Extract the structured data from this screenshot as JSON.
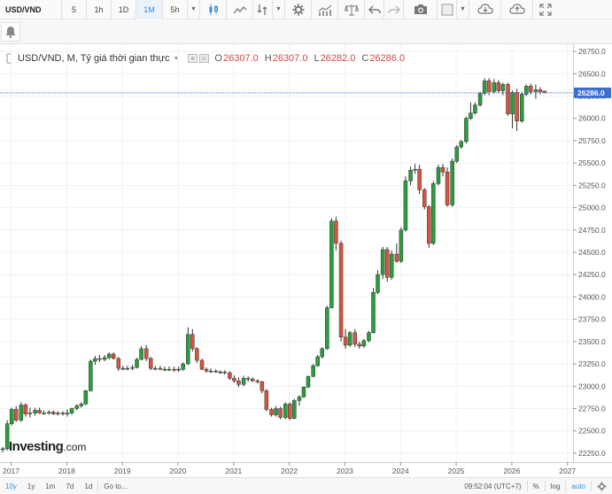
{
  "toolbar": {
    "symbol": "USD/VND",
    "intervals": [
      {
        "label": "5",
        "active": false
      },
      {
        "label": "1h",
        "active": false
      },
      {
        "label": "1D",
        "active": false
      },
      {
        "label": "1M",
        "active": true
      },
      {
        "label": "5h",
        "active": false
      }
    ],
    "icons": [
      "candlestick-icon",
      "line-chart-icon",
      "indicators-icon",
      "settings-icon",
      "bar-chart-icon",
      "scales-icon",
      "undo-icon",
      "redo-icon",
      "camera-icon",
      "square-icon",
      "cloud-down-icon",
      "cloud-up-icon",
      "fullscreen-icon"
    ]
  },
  "legend": {
    "title": "USD/VND, M, Tỷ giá thời gian thực",
    "open_label": "O",
    "open": "26307.0",
    "high_label": "H",
    "high": "26307.0",
    "low_label": "L",
    "low": "26282.0",
    "close_label": "C",
    "close": "26286.0"
  },
  "bottombar": {
    "ranges": [
      {
        "label": "10y",
        "active": true
      },
      {
        "label": "1y",
        "active": false
      },
      {
        "label": "1m",
        "active": false
      },
      {
        "label": "7d",
        "active": false
      },
      {
        "label": "1d",
        "active": false
      }
    ],
    "goto": "Go to...",
    "time": "09:52:04 (UTC+7)",
    "percent": "%",
    "log": "log",
    "auto": "auto"
  },
  "brand": {
    "name": "Investing",
    "suffix": ".com"
  },
  "colors": {
    "up": "#2a9d3f",
    "down": "#d75442",
    "price_line": "#3b6fcf",
    "price_tag": "#3b6fcf",
    "grid": "#f1f1f1"
  },
  "chart_data": {
    "type": "candlestick",
    "interval": "monthly",
    "y_ticks": [
      22250,
      22500,
      22750,
      23000,
      23250,
      23500,
      23750,
      24000,
      24250,
      24500,
      24750,
      25000,
      25250,
      25500,
      25750,
      26000,
      26250,
      26500,
      26750
    ],
    "y_range": [
      22150,
      26830
    ],
    "x_ticks": [
      "2017",
      "2018",
      "2019",
      "2020",
      "2021",
      "2022",
      "2023",
      "2024",
      "2025",
      "2026",
      "2027"
    ],
    "x_range": [
      2016.8,
      2027.1
    ],
    "last_price": 26286.0,
    "last_price_label": "26286.0",
    "candles": [
      {
        "t": 2016.85,
        "o": 22290,
        "h": 22320,
        "l": 22260,
        "c": 22300
      },
      {
        "t": 2016.93,
        "o": 22300,
        "h": 22620,
        "l": 22280,
        "c": 22580
      },
      {
        "t": 2017.01,
        "o": 22580,
        "h": 22760,
        "l": 22560,
        "c": 22740
      },
      {
        "t": 2017.09,
        "o": 22740,
        "h": 22780,
        "l": 22600,
        "c": 22620
      },
      {
        "t": 2017.18,
        "o": 22620,
        "h": 22820,
        "l": 22600,
        "c": 22790
      },
      {
        "t": 2017.26,
        "o": 22790,
        "h": 22810,
        "l": 22660,
        "c": 22690
      },
      {
        "t": 2017.34,
        "o": 22690,
        "h": 22760,
        "l": 22650,
        "c": 22700
      },
      {
        "t": 2017.43,
        "o": 22700,
        "h": 22760,
        "l": 22670,
        "c": 22730
      },
      {
        "t": 2017.51,
        "o": 22730,
        "h": 22760,
        "l": 22690,
        "c": 22700
      },
      {
        "t": 2017.59,
        "o": 22700,
        "h": 22730,
        "l": 22680,
        "c": 22700
      },
      {
        "t": 2017.68,
        "o": 22700,
        "h": 22730,
        "l": 22680,
        "c": 22710
      },
      {
        "t": 2017.76,
        "o": 22710,
        "h": 22730,
        "l": 22680,
        "c": 22690
      },
      {
        "t": 2017.84,
        "o": 22690,
        "h": 22720,
        "l": 22670,
        "c": 22700
      },
      {
        "t": 2017.93,
        "o": 22700,
        "h": 22720,
        "l": 22670,
        "c": 22690
      },
      {
        "t": 2018.01,
        "o": 22690,
        "h": 22740,
        "l": 22660,
        "c": 22700
      },
      {
        "t": 2018.09,
        "o": 22700,
        "h": 22760,
        "l": 22680,
        "c": 22750
      },
      {
        "t": 2018.18,
        "o": 22750,
        "h": 22800,
        "l": 22730,
        "c": 22780
      },
      {
        "t": 2018.26,
        "o": 22780,
        "h": 22820,
        "l": 22760,
        "c": 22800
      },
      {
        "t": 2018.34,
        "o": 22800,
        "h": 22960,
        "l": 22790,
        "c": 22950
      },
      {
        "t": 2018.43,
        "o": 22950,
        "h": 23300,
        "l": 22940,
        "c": 23280
      },
      {
        "t": 2018.51,
        "o": 23280,
        "h": 23340,
        "l": 23240,
        "c": 23310
      },
      {
        "t": 2018.59,
        "o": 23310,
        "h": 23350,
        "l": 23270,
        "c": 23300
      },
      {
        "t": 2018.68,
        "o": 23300,
        "h": 23350,
        "l": 23280,
        "c": 23320
      },
      {
        "t": 2018.76,
        "o": 23320,
        "h": 23380,
        "l": 23300,
        "c": 23360
      },
      {
        "t": 2018.84,
        "o": 23360,
        "h": 23380,
        "l": 23300,
        "c": 23310
      },
      {
        "t": 2018.93,
        "o": 23310,
        "h": 23330,
        "l": 23170,
        "c": 23200
      },
      {
        "t": 2019.01,
        "o": 23200,
        "h": 23230,
        "l": 23180,
        "c": 23200
      },
      {
        "t": 2019.09,
        "o": 23200,
        "h": 23230,
        "l": 23180,
        "c": 23200
      },
      {
        "t": 2019.18,
        "o": 23200,
        "h": 23240,
        "l": 23180,
        "c": 23210
      },
      {
        "t": 2019.26,
        "o": 23210,
        "h": 23320,
        "l": 23200,
        "c": 23300
      },
      {
        "t": 2019.34,
        "o": 23300,
        "h": 23450,
        "l": 23290,
        "c": 23420
      },
      {
        "t": 2019.43,
        "o": 23420,
        "h": 23460,
        "l": 23280,
        "c": 23310
      },
      {
        "t": 2019.51,
        "o": 23310,
        "h": 23330,
        "l": 23180,
        "c": 23200
      },
      {
        "t": 2019.59,
        "o": 23200,
        "h": 23230,
        "l": 23180,
        "c": 23200
      },
      {
        "t": 2019.68,
        "o": 23200,
        "h": 23230,
        "l": 23180,
        "c": 23190
      },
      {
        "t": 2019.76,
        "o": 23190,
        "h": 23220,
        "l": 23170,
        "c": 23190
      },
      {
        "t": 2019.84,
        "o": 23190,
        "h": 23220,
        "l": 23170,
        "c": 23190
      },
      {
        "t": 2019.93,
        "o": 23190,
        "h": 23220,
        "l": 23160,
        "c": 23180
      },
      {
        "t": 2020.01,
        "o": 23180,
        "h": 23220,
        "l": 23160,
        "c": 23190
      },
      {
        "t": 2020.09,
        "o": 23190,
        "h": 23270,
        "l": 23170,
        "c": 23250
      },
      {
        "t": 2020.18,
        "o": 23250,
        "h": 23660,
        "l": 23240,
        "c": 23580
      },
      {
        "t": 2020.26,
        "o": 23580,
        "h": 23640,
        "l": 23390,
        "c": 23420
      },
      {
        "t": 2020.34,
        "o": 23420,
        "h": 23440,
        "l": 23260,
        "c": 23290
      },
      {
        "t": 2020.43,
        "o": 23290,
        "h": 23310,
        "l": 23180,
        "c": 23190
      },
      {
        "t": 2020.51,
        "o": 23190,
        "h": 23210,
        "l": 23150,
        "c": 23170
      },
      {
        "t": 2020.59,
        "o": 23170,
        "h": 23200,
        "l": 23150,
        "c": 23170
      },
      {
        "t": 2020.68,
        "o": 23170,
        "h": 23190,
        "l": 23150,
        "c": 23160
      },
      {
        "t": 2020.76,
        "o": 23160,
        "h": 23180,
        "l": 23140,
        "c": 23160
      },
      {
        "t": 2020.84,
        "o": 23160,
        "h": 23180,
        "l": 23130,
        "c": 23150
      },
      {
        "t": 2020.93,
        "o": 23150,
        "h": 23170,
        "l": 23070,
        "c": 23090
      },
      {
        "t": 2021.01,
        "o": 23090,
        "h": 23120,
        "l": 23040,
        "c": 23060
      },
      {
        "t": 2021.09,
        "o": 23060,
        "h": 23100,
        "l": 22990,
        "c": 23020
      },
      {
        "t": 2021.18,
        "o": 23020,
        "h": 23120,
        "l": 23000,
        "c": 23090
      },
      {
        "t": 2021.26,
        "o": 23090,
        "h": 23110,
        "l": 23050,
        "c": 23080
      },
      {
        "t": 2021.34,
        "o": 23080,
        "h": 23100,
        "l": 23050,
        "c": 23060
      },
      {
        "t": 2021.43,
        "o": 23060,
        "h": 23080,
        "l": 23030,
        "c": 23050
      },
      {
        "t": 2021.51,
        "o": 23050,
        "h": 23060,
        "l": 22920,
        "c": 22950
      },
      {
        "t": 2021.59,
        "o": 22950,
        "h": 22970,
        "l": 22720,
        "c": 22740
      },
      {
        "t": 2021.68,
        "o": 22740,
        "h": 22760,
        "l": 22660,
        "c": 22680
      },
      {
        "t": 2021.76,
        "o": 22680,
        "h": 22780,
        "l": 22660,
        "c": 22750
      },
      {
        "t": 2021.84,
        "o": 22750,
        "h": 22770,
        "l": 22630,
        "c": 22650
      },
      {
        "t": 2021.93,
        "o": 22650,
        "h": 22820,
        "l": 22630,
        "c": 22800
      },
      {
        "t": 2022.01,
        "o": 22800,
        "h": 22820,
        "l": 22620,
        "c": 22640
      },
      {
        "t": 2022.09,
        "o": 22640,
        "h": 22860,
        "l": 22630,
        "c": 22840
      },
      {
        "t": 2022.18,
        "o": 22840,
        "h": 22900,
        "l": 22780,
        "c": 22880
      },
      {
        "t": 2022.26,
        "o": 22880,
        "h": 23000,
        "l": 22870,
        "c": 22990
      },
      {
        "t": 2022.34,
        "o": 22990,
        "h": 23120,
        "l": 22980,
        "c": 23110
      },
      {
        "t": 2022.43,
        "o": 23110,
        "h": 23250,
        "l": 23100,
        "c": 23230
      },
      {
        "t": 2022.51,
        "o": 23230,
        "h": 23350,
        "l": 23220,
        "c": 23330
      },
      {
        "t": 2022.59,
        "o": 23330,
        "h": 23440,
        "l": 23310,
        "c": 23420
      },
      {
        "t": 2022.68,
        "o": 23420,
        "h": 23900,
        "l": 23410,
        "c": 23880
      },
      {
        "t": 2022.76,
        "o": 23880,
        "h": 24880,
        "l": 23870,
        "c": 24850
      },
      {
        "t": 2022.84,
        "o": 24850,
        "h": 24900,
        "l": 24520,
        "c": 24600
      },
      {
        "t": 2022.93,
        "o": 24600,
        "h": 24630,
        "l": 23500,
        "c": 23550
      },
      {
        "t": 2023.01,
        "o": 23550,
        "h": 23640,
        "l": 23420,
        "c": 23460
      },
      {
        "t": 2023.09,
        "o": 23460,
        "h": 23620,
        "l": 23440,
        "c": 23600
      },
      {
        "t": 2023.18,
        "o": 23600,
        "h": 23640,
        "l": 23440,
        "c": 23470
      },
      {
        "t": 2023.26,
        "o": 23470,
        "h": 23500,
        "l": 23420,
        "c": 23450
      },
      {
        "t": 2023.34,
        "o": 23450,
        "h": 23530,
        "l": 23430,
        "c": 23510
      },
      {
        "t": 2023.43,
        "o": 23510,
        "h": 23620,
        "l": 23490,
        "c": 23600
      },
      {
        "t": 2023.51,
        "o": 23600,
        "h": 24100,
        "l": 23590,
        "c": 24050
      },
      {
        "t": 2023.59,
        "o": 24050,
        "h": 24300,
        "l": 24030,
        "c": 24250
      },
      {
        "t": 2023.68,
        "o": 24250,
        "h": 24560,
        "l": 24200,
        "c": 24530
      },
      {
        "t": 2023.76,
        "o": 24530,
        "h": 24560,
        "l": 24170,
        "c": 24220
      },
      {
        "t": 2023.84,
        "o": 24220,
        "h": 24520,
        "l": 24190,
        "c": 24480
      },
      {
        "t": 2023.93,
        "o": 24480,
        "h": 24600,
        "l": 24380,
        "c": 24400
      },
      {
        "t": 2024.01,
        "o": 24400,
        "h": 24780,
        "l": 24380,
        "c": 24750
      },
      {
        "t": 2024.09,
        "o": 24750,
        "h": 25350,
        "l": 24730,
        "c": 25300
      },
      {
        "t": 2024.18,
        "o": 25300,
        "h": 25460,
        "l": 25250,
        "c": 25420
      },
      {
        "t": 2024.26,
        "o": 25420,
        "h": 25490,
        "l": 25380,
        "c": 25430
      },
      {
        "t": 2024.34,
        "o": 25430,
        "h": 25480,
        "l": 25150,
        "c": 25200
      },
      {
        "t": 2024.43,
        "o": 25200,
        "h": 25220,
        "l": 24980,
        "c": 25010
      },
      {
        "t": 2024.51,
        "o": 25010,
        "h": 25030,
        "l": 24550,
        "c": 24600
      },
      {
        "t": 2024.59,
        "o": 24600,
        "h": 25300,
        "l": 24580,
        "c": 25270
      },
      {
        "t": 2024.68,
        "o": 25270,
        "h": 25480,
        "l": 25250,
        "c": 25450
      },
      {
        "t": 2024.76,
        "o": 25450,
        "h": 25490,
        "l": 25350,
        "c": 25400
      },
      {
        "t": 2024.84,
        "o": 25400,
        "h": 25450,
        "l": 25010,
        "c": 25030
      },
      {
        "t": 2024.93,
        "o": 25030,
        "h": 25550,
        "l": 25010,
        "c": 25520
      },
      {
        "t": 2025.01,
        "o": 25520,
        "h": 25700,
        "l": 25500,
        "c": 25680
      },
      {
        "t": 2025.09,
        "o": 25680,
        "h": 25760,
        "l": 25660,
        "c": 25740
      },
      {
        "t": 2025.18,
        "o": 25740,
        "h": 26020,
        "l": 25720,
        "c": 26000
      },
      {
        "t": 2025.26,
        "o": 26000,
        "h": 26180,
        "l": 25980,
        "c": 26060
      },
      {
        "t": 2025.34,
        "o": 26060,
        "h": 26180,
        "l": 26040,
        "c": 26150
      },
      {
        "t": 2025.43,
        "o": 26150,
        "h": 26300,
        "l": 26130,
        "c": 26280
      },
      {
        "t": 2025.51,
        "o": 26280,
        "h": 26450,
        "l": 26260,
        "c": 26420
      },
      {
        "t": 2025.59,
        "o": 26420,
        "h": 26450,
        "l": 26260,
        "c": 26300
      },
      {
        "t": 2025.68,
        "o": 26300,
        "h": 26440,
        "l": 26280,
        "c": 26400
      },
      {
        "t": 2025.76,
        "o": 26400,
        "h": 26430,
        "l": 26280,
        "c": 26310
      },
      {
        "t": 2025.84,
        "o": 26310,
        "h": 26400,
        "l": 26260,
        "c": 26380
      },
      {
        "t": 2025.93,
        "o": 26380,
        "h": 26400,
        "l": 26030,
        "c": 26050
      },
      {
        "t": 2026.01,
        "o": 26050,
        "h": 26310,
        "l": 25890,
        "c": 26290
      },
      {
        "t": 2026.09,
        "o": 26290,
        "h": 26330,
        "l": 25860,
        "c": 25970
      },
      {
        "t": 2026.18,
        "o": 25970,
        "h": 26290,
        "l": 25950,
        "c": 26270
      },
      {
        "t": 2026.26,
        "o": 26270,
        "h": 26380,
        "l": 26250,
        "c": 26360
      },
      {
        "t": 2026.34,
        "o": 26360,
        "h": 26390,
        "l": 26270,
        "c": 26300
      },
      {
        "t": 2026.43,
        "o": 26300,
        "h": 26380,
        "l": 26220,
        "c": 26320
      },
      {
        "t": 2026.51,
        "o": 26320,
        "h": 26350,
        "l": 26270,
        "c": 26300
      },
      {
        "t": 2026.59,
        "o": 26307,
        "h": 26307,
        "l": 26282,
        "c": 26286
      }
    ]
  }
}
